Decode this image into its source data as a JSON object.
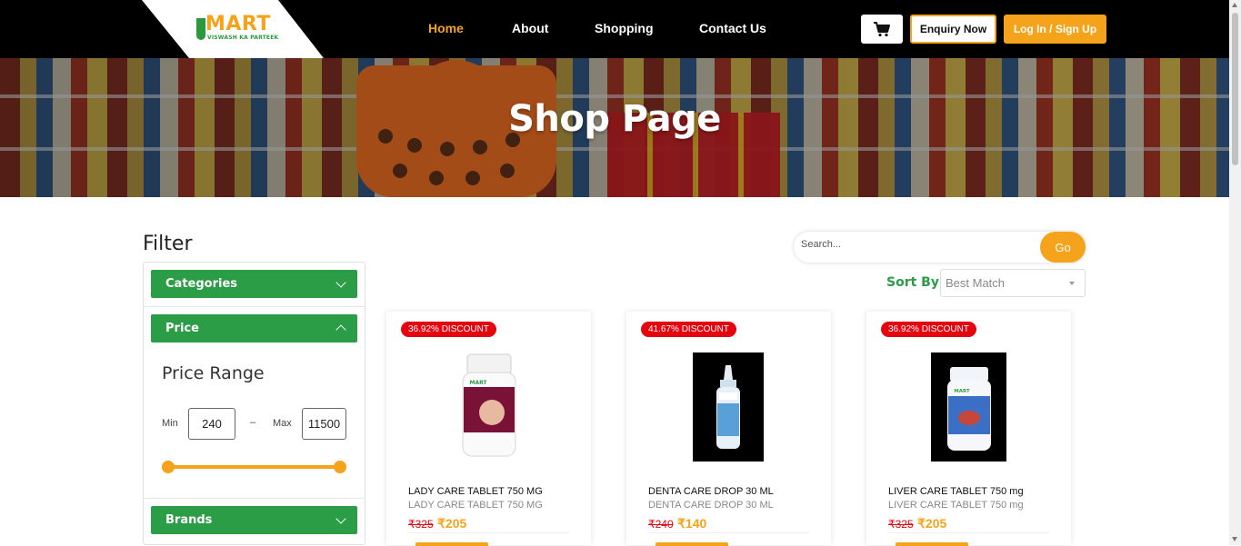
{
  "brand": {
    "logo_text": "MART",
    "tagline": "VISWASH KA PARTEEK"
  },
  "nav": {
    "items": [
      {
        "label": "Home",
        "active": true
      },
      {
        "label": "About",
        "active": false
      },
      {
        "label": "Shopping",
        "active": false
      },
      {
        "label": "Contact Us",
        "active": false
      }
    ]
  },
  "header_actions": {
    "cart_icon": "cart-icon",
    "enquiry_label": "Enquiry Now",
    "login_label": "Log In / Sign Up"
  },
  "banner": {
    "title": "Shop Page"
  },
  "filter": {
    "title": "Filter",
    "sections": {
      "categories": "Categories",
      "price": "Price",
      "brands": "Brands"
    },
    "price_range": {
      "title": "Price Range",
      "min_label": "Min",
      "max_label": "Max",
      "separator": "–",
      "min_value": "240",
      "max_value": "11500"
    }
  },
  "search": {
    "placeholder": "Search...",
    "go_label": "Go"
  },
  "sort": {
    "label": "Sort By",
    "selected": "Best Match"
  },
  "products": [
    {
      "discount": "36.92% DISCOUNT",
      "name": "LADY CARE TABLET 750 MG",
      "subtitle": "LADY CARE TABLET 750 MG",
      "old_price": "₹325",
      "new_price": "₹205"
    },
    {
      "discount": "41.67% DISCOUNT",
      "name": "DENTA CARE DROP 30 ML",
      "subtitle": "DENTA CARE DROP 30 ML",
      "old_price": "₹240",
      "new_price": "₹140"
    },
    {
      "discount": "36.92% DISCOUNT",
      "name": "LIVER CARE TABLET 750 mg",
      "subtitle": "LIVER CARE TABLET 750 mg",
      "old_price": "₹325",
      "new_price": "₹205"
    }
  ],
  "colors": {
    "accent_orange": "#f5a31a",
    "green": "#2a9d46",
    "discount_red": "#e5050f",
    "header_bg": "#000000"
  }
}
